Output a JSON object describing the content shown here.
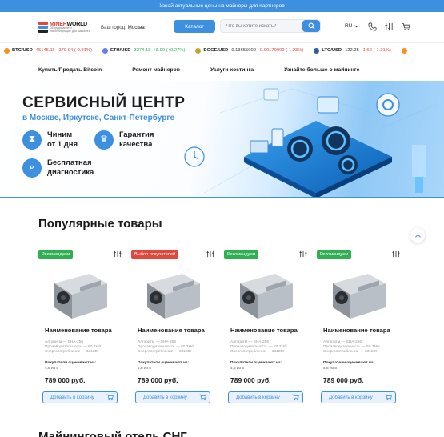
{
  "topbar": {
    "text": "Узнай актуальные цены на майнеры для партнеров"
  },
  "header": {
    "logo_name_prefix": "MINER",
    "logo_name_suffix": "WORLD",
    "logo_tagline": "Оборудование и комплектующие для майнинга",
    "city_label": "Ваш город:",
    "city_value": "Москва",
    "catalog_label": "Каталог",
    "search_placeholder": "Что вы хотите искать?",
    "lang": "RU"
  },
  "ticker": [
    {
      "pair": "BTC/USD",
      "price": "45145.11",
      "change": "-370.94 (-0.81%)",
      "dir": "down",
      "icon": "btc-coin-icon",
      "color": "#f7931a"
    },
    {
      "pair": "ETH/USD",
      "price": "3274.18",
      "change": "+8.90 (+0.27%)",
      "dir": "up",
      "icon": "eth-coin-icon",
      "color": "#627eea"
    },
    {
      "pair": "DOGE/USD",
      "price": "0.13655000",
      "change": "-0.00170000 (-1.23%)",
      "dir": "down",
      "icon": "doge-coin-icon",
      "color": "#c2a633"
    },
    {
      "pair": "LTC/USD",
      "price": "122.25",
      "change": "-1.62 (-1.31%)",
      "dir": "down",
      "icon": "ltc-coin-icon",
      "color": "#345d9d"
    }
  ],
  "nav": [
    "Купить/Продать Bitcoin",
    "Ремонт майнеров",
    "Услуги хостинга",
    "Узнайте больше о майнинге"
  ],
  "banner": {
    "title": "СЕРВИСНЫЙ ЦЕНТР",
    "subtitle": "в Москве, Иркутске, Санкт-Петербурге",
    "features": [
      {
        "line1": "Чиним",
        "line2": "от 1 дня"
      },
      {
        "line1": "Гарантия",
        "line2": "качества"
      },
      {
        "line1": "Бесплатная",
        "line2": "диагностика"
      }
    ]
  },
  "popular": {
    "title": "Популярные товары",
    "products": [
      {
        "badge": "Рекомендуем",
        "badge_color": "green",
        "name": "Наименование товара",
        "spec1": "Алгоритм — SHA-256",
        "spec2": "Производительность — 80 TH/s",
        "spec3": "Энергопотребление — 3312Вт",
        "rating_label": "Покупатели оценивают на:",
        "rating": "4,6 из 5",
        "price": "789 000 руб.",
        "cart": "Добавить в корзину"
      },
      {
        "badge": "Выбор покупателей",
        "badge_color": "red",
        "name": "Наименование товара",
        "spec1": "Алгоритм — SHA-256",
        "spec2": "Производительность — 80 TH/s",
        "spec3": "Энергопотребление — 3312Вт",
        "rating_label": "Покупатели оценивают на:",
        "rating": "4,6 из 5",
        "price": "789 000 руб.",
        "cart": "Добавить в корзину"
      },
      {
        "badge": "Рекомендуем",
        "badge_color": "green",
        "name": "Наименование товара",
        "spec1": "Алгоритм — SHA-256",
        "spec2": "Производительность — 80 TH/s",
        "spec3": "Энергопотребление — 3312Вт",
        "rating_label": "Покупатели оценивают на:",
        "rating": "4,6 из 5",
        "price": "789 000 руб.",
        "cart": "Добавить в корзину"
      },
      {
        "badge": "Рекомендуем",
        "badge_color": "green",
        "name": "Наименование товара",
        "spec1": "Алгоритм — SHA-256",
        "spec2": "Производительность — 80 TH/s",
        "spec3": "Энергопотребление — 3312Вт",
        "rating_label": "Покупатели оценивают на:",
        "rating": "4,6 из 5",
        "price": "789 000 руб.",
        "cart": "Добавить в корзину"
      }
    ]
  },
  "next_section": {
    "title": "Майнинговый отель СНГ"
  },
  "colors": {
    "accent": "#3d8fe0",
    "badge_green": "#2fae52",
    "badge_red": "#e2473b"
  }
}
